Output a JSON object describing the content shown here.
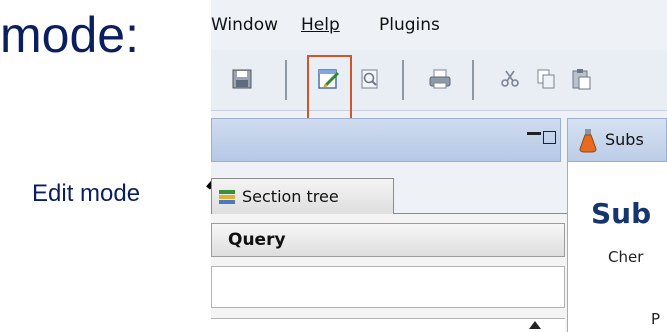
{
  "slide": {
    "title": "mode:",
    "label": "Edit mode"
  },
  "menu": {
    "items": [
      {
        "label": "Window",
        "underline_first": false
      },
      {
        "label": "Help",
        "underline_first": true
      },
      {
        "label": "Plugins",
        "underline_first": false
      }
    ]
  },
  "toolbar": {
    "buttons": [
      "save-icon",
      "edit-mode-icon",
      "preview-icon",
      "print-icon",
      "cut-icon",
      "copy-icon",
      "paste-icon"
    ]
  },
  "left_panel": {
    "section_tab": "Section tree",
    "query_header": "Query"
  },
  "right_panel": {
    "tab_label": "Subs",
    "title": "Sub",
    "subtitle": "Cher",
    "fragment": "P"
  },
  "colors": {
    "slide_text": "#0b1f5e",
    "highlight": "#d2552a",
    "panel_header": "#bccde7"
  }
}
